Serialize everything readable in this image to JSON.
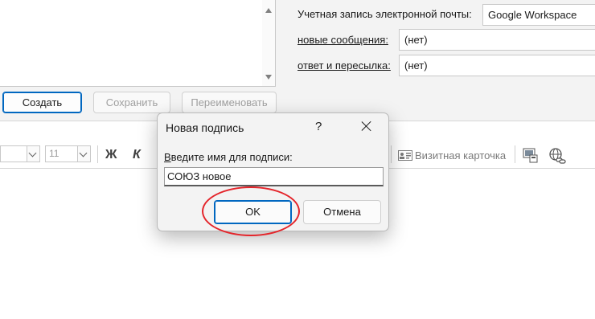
{
  "signature_editor": {
    "buttons": {
      "create": "Создать",
      "save": "Сохранить",
      "rename": "Переименовать"
    }
  },
  "default_signature": {
    "email_account_label": "Учетная запись электронной почты:",
    "email_account_value": "Google Workspace",
    "new_messages_label": "новые сообщения:",
    "new_messages_value": "(нет)",
    "replies_label": "ответ и пересылка:",
    "replies_value": "(нет)"
  },
  "toolbar": {
    "font_size": "11",
    "bold_label": "Ж",
    "italic_label": "К",
    "business_card_label": "Визитная карточка",
    "icons": [
      "bold-icon",
      "italic-icon",
      "business-card-icon",
      "picture-icon",
      "hyperlink-icon"
    ]
  },
  "dialog": {
    "title": "Новая подпись",
    "help_label": "?",
    "prompt": "Введите имя для подписи:",
    "input_value": "СОЮЗ новое",
    "ok_label": "OK",
    "cancel_label": "Отмена"
  },
  "colors": {
    "accent": "#0067c0",
    "highlight": "#e4242a"
  }
}
